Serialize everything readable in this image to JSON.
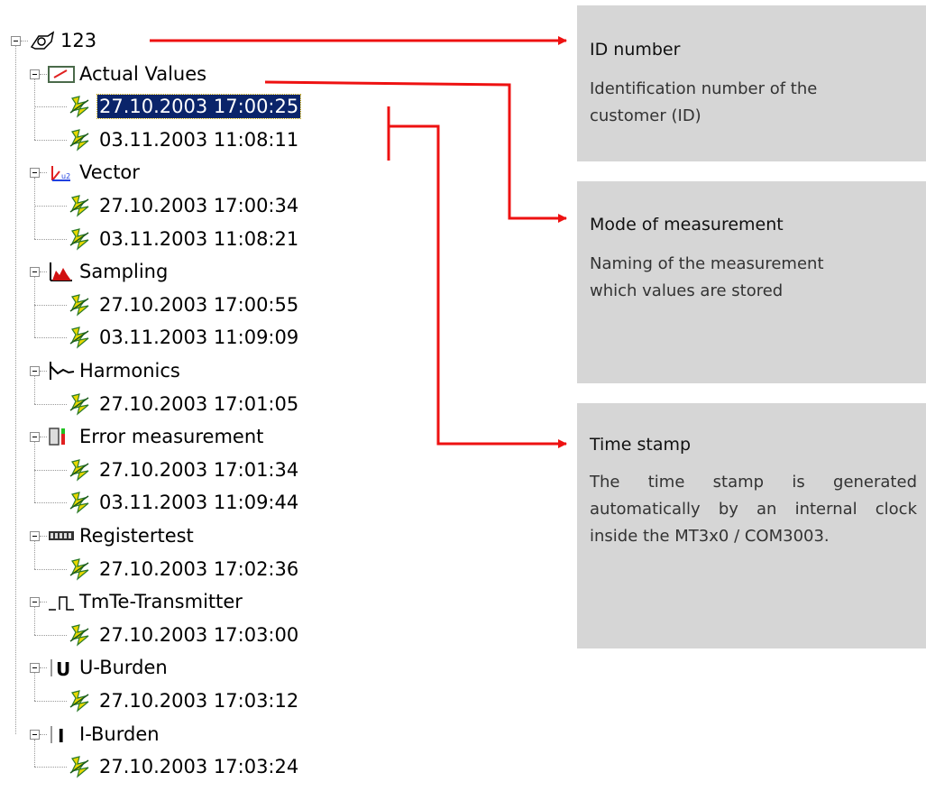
{
  "colors": {
    "callout_line": "#ee1111",
    "panel_bg": "#d6d6d6",
    "selection_bg": "#0a246a"
  },
  "tree": {
    "root": {
      "label": "123",
      "icon": "customer-root-icon"
    },
    "groups": [
      {
        "label": "Actual Values",
        "icon": "actual-values-icon",
        "children": [
          "27.10.2003 17:00:25",
          "03.11.2003 11:08:11"
        ],
        "selected_child": 0
      },
      {
        "label": "Vector",
        "icon": "vector-icon",
        "children": [
          "27.10.2003 17:00:34",
          "03.11.2003 11:08:21"
        ]
      },
      {
        "label": "Sampling",
        "icon": "sampling-icon",
        "children": [
          "27.10.2003 17:00:55",
          "03.11.2003 11:09:09"
        ]
      },
      {
        "label": "Harmonics",
        "icon": "harmonics-icon",
        "children": [
          "27.10.2003 17:01:05"
        ]
      },
      {
        "label": "Error measurement",
        "icon": "error-measurement-icon",
        "children": [
          "27.10.2003 17:01:34",
          "03.11.2003 11:09:44"
        ]
      },
      {
        "label": "Registertest",
        "icon": "registertest-icon",
        "children": [
          "27.10.2003 17:02:36"
        ]
      },
      {
        "label": "TmTe-Transmitter",
        "icon": "transmitter-icon",
        "children": [
          "27.10.2003 17:03:00"
        ]
      },
      {
        "label": "U-Burden",
        "icon": "u-burden-icon",
        "children": [
          "27.10.2003 17:03:12"
        ]
      },
      {
        "label": "I-Burden",
        "icon": "i-burden-icon",
        "children": [
          "27.10.2003 17:03:24"
        ]
      }
    ]
  },
  "callouts": [
    {
      "title": "ID number",
      "text": "Identification number of the customer (ID)"
    },
    {
      "title": "Mode of measurement",
      "text": "Naming of the measurement which values are stored"
    },
    {
      "title": "Time stamp",
      "text": "The time stamp is generated automatically by an internal clock inside the MT3x0 / COM3003."
    }
  ]
}
